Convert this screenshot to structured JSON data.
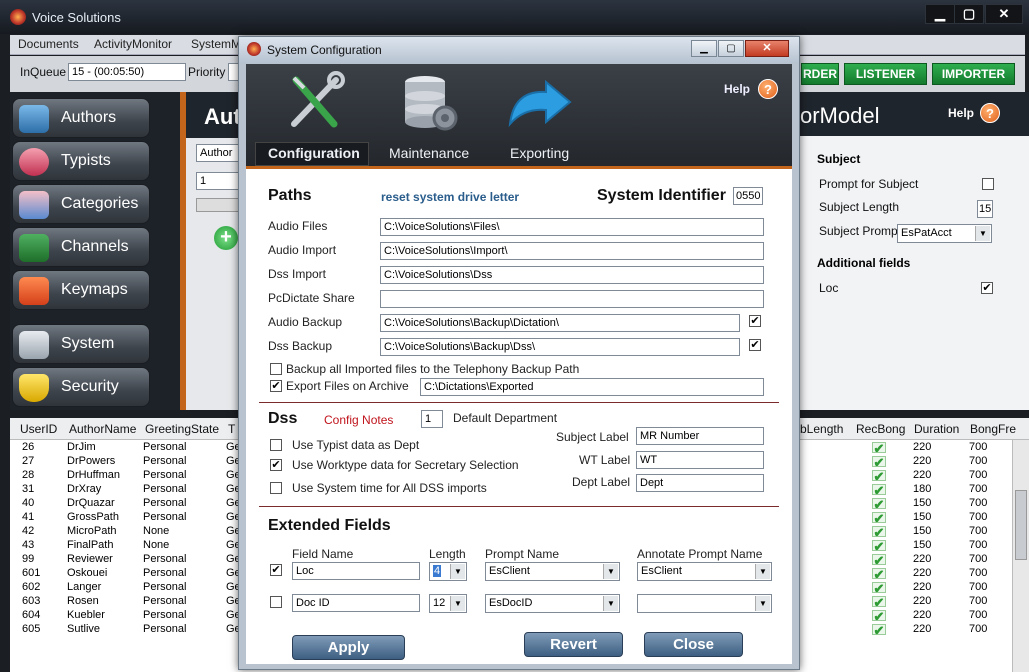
{
  "app": {
    "title": "Voice Solutions"
  },
  "menu": [
    "Documents",
    "ActivityMonitor",
    "SystemM"
  ],
  "toolbar": {
    "inqueue_label": "InQueue",
    "inqueue_value": "15 - (00:05:50)",
    "priority_label": "Priority",
    "buttons": [
      "RDER",
      "LISTENER",
      "IMPORTER"
    ]
  },
  "sidebar": {
    "items": [
      "Authors",
      "Typists",
      "Categories",
      "Channels",
      "Keymaps",
      "System",
      "Security"
    ]
  },
  "behind": {
    "title_partial": "Aut",
    "combo_value": "Author",
    "field_value": "1",
    "rightmodel_title": "orModel",
    "help_label": "Help",
    "subject_head": "Subject",
    "prompt_for_subject": "Prompt for Subject",
    "subject_length_label": "Subject Length",
    "subject_length_value": "15",
    "subject_prompt_label": "Subject Prompt",
    "subject_prompt_value": "EsPatAcct",
    "additional_fields": "Additional fields",
    "loc_label": "Loc"
  },
  "grid": {
    "headers": [
      "UserID",
      "AuthorName",
      "GreetingState",
      "T",
      "bLength",
      "RecBong",
      "Duration",
      "BongFre"
    ],
    "rows": [
      [
        "26",
        "DrJim",
        "Personal",
        "220",
        "700"
      ],
      [
        "27",
        "DrPowers",
        "Personal",
        "220",
        "700"
      ],
      [
        "28",
        "DrHuffman",
        "Personal",
        "220",
        "700"
      ],
      [
        "31",
        "DrXray",
        "Personal",
        "180",
        "700"
      ],
      [
        "40",
        "DrQuazar",
        "Personal",
        "150",
        "700"
      ],
      [
        "41",
        "GrossPath",
        "Personal",
        "150",
        "700"
      ],
      [
        "42",
        "MicroPath",
        "None",
        "150",
        "700"
      ],
      [
        "43",
        "FinalPath",
        "None",
        "150",
        "700"
      ],
      [
        "99",
        "Reviewer",
        "Personal",
        "220",
        "700"
      ],
      [
        "601",
        "Oskouei",
        "Personal",
        "220",
        "700"
      ],
      [
        "602",
        "Langer",
        "Personal",
        "220",
        "700"
      ],
      [
        "603",
        "Rosen",
        "Personal",
        "220",
        "700"
      ],
      [
        "604",
        "Kuebler",
        "Personal",
        "220",
        "700"
      ],
      [
        "605",
        "Sutlive",
        "Personal",
        "220",
        "700"
      ]
    ],
    "col_partial": "Ge"
  },
  "dialog": {
    "title": "System Configuration",
    "help_label": "Help",
    "tabs": [
      "Configuration",
      "Maintenance",
      "Exporting"
    ],
    "paths": {
      "heading": "Paths",
      "reset_link": "reset system drive letter",
      "system_identifier_label": "System Identifier",
      "system_identifier_value": "0550",
      "audio_files_label": "Audio Files",
      "audio_files_value": "C:\\VoiceSolutions\\Files\\",
      "audio_import_label": "Audio Import",
      "audio_import_value": "C:\\VoiceSolutions\\Import\\",
      "dss_import_label": "Dss Import",
      "dss_import_value": "C:\\VoiceSolutions\\Dss",
      "pcdictate_label": "PcDictate Share",
      "pcdictate_value": "",
      "audio_backup_label": "Audio Backup",
      "audio_backup_value": "C:\\VoiceSolutions\\Backup\\Dictation\\",
      "dss_backup_label": "Dss Backup",
      "dss_backup_value": "C:\\VoiceSolutions\\Backup\\Dss\\",
      "backup_imported_label": "Backup all Imported files to the Telephony Backup Path",
      "export_archive_label": "Export Files on Archive",
      "export_archive_value": "C:\\Dictations\\Exported"
    },
    "dss": {
      "heading": "Dss",
      "config_notes": "Config Notes",
      "default_dept_value": "1",
      "default_dept_label": "Default Department",
      "use_typist_label": "Use Typist data as Dept",
      "use_worktype_label": "Use Worktype data for Secretary Selection",
      "use_system_time_label": "Use System time for All DSS imports",
      "subject_label_label": "Subject Label",
      "subject_label_value": "MR Number",
      "wt_label_label": "WT Label",
      "wt_label_value": "WT",
      "dept_label_label": "Dept Label",
      "dept_label_value": "Dept"
    },
    "extended": {
      "heading": "Extended Fields",
      "col_field_name": "Field Name",
      "col_length": "Length",
      "col_prompt_name": "Prompt Name",
      "col_annotate": "Annotate Prompt Name",
      "rows": [
        {
          "field": "Loc",
          "length": "4",
          "prompt": "EsClient",
          "annotate": "EsClient"
        },
        {
          "field": "Doc ID",
          "length": "12",
          "prompt": "EsDocID",
          "annotate": ""
        }
      ]
    },
    "buttons": {
      "apply": "Apply",
      "revert": "Revert",
      "close": "Close"
    }
  },
  "colors": {
    "accent_orange": "#c4651c",
    "green_button": "#137a2d",
    "link_blue": "#2a5d8c",
    "config_notes_red": "#c0141c"
  }
}
